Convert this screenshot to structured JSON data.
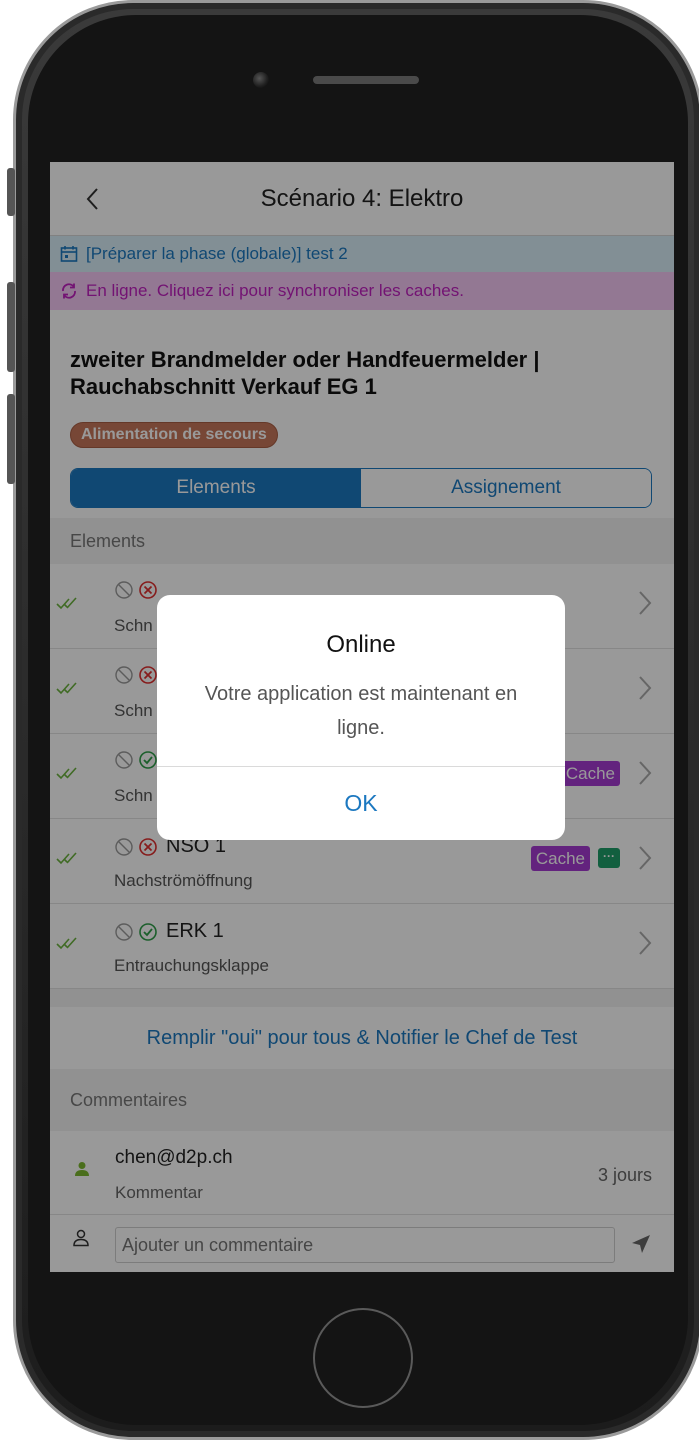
{
  "header": {
    "title": "Scénario 4: Elektro"
  },
  "banners": {
    "phase": "[Préparer la phase (globale)] test 2",
    "sync": "En ligne. Cliquez ici pour synchroniser les caches."
  },
  "task": {
    "title": "zweiter Brandmelder oder Handfeuermelder | Rauchabschnitt Verkauf EG 1",
    "tag": "Alimentation de secours"
  },
  "segments": {
    "elements": "Elements",
    "assignment": "Assignement"
  },
  "elements_section": {
    "title": "Elements",
    "items": [
      {
        "name": "",
        "sub": "Schn",
        "status": "error",
        "cache": "",
        "comment": false
      },
      {
        "name": "",
        "sub": "Schn",
        "status": "error",
        "cache": "",
        "comment": false
      },
      {
        "name": "",
        "sub": "Schn",
        "status": "ok",
        "cache": "Cache",
        "comment": false
      },
      {
        "name": "NSÖ 1",
        "sub": "Nachströmöffnung",
        "status": "error",
        "cache": "Cache",
        "comment": true
      },
      {
        "name": "ERK 1",
        "sub": "Entrauchungsklappe",
        "status": "ok",
        "cache": "",
        "comment": false
      }
    ]
  },
  "notify_action": "Remplir \"oui\" pour tous & Notifier le Chef de Test",
  "comments": {
    "title": "Commentaires",
    "items": [
      {
        "author": "chen@d2p.ch",
        "text": "Kommentar",
        "time": "3 jours"
      }
    ],
    "input_placeholder": "Ajouter un commentaire"
  },
  "dialog": {
    "title": "Online",
    "message": "Votre application est maintenant en ligne.",
    "button": "OK"
  },
  "colors": {
    "primary": "#1c78c0",
    "sync_banner_bg": "#f6c8f6",
    "sync_banner_text": "#c021c0",
    "phase_banner_bg": "#d9eef8",
    "tag_bg": "#c7775a",
    "cache_badge": "#a53bd2",
    "check_green": "#6cb33f",
    "error_red": "#e03030"
  }
}
